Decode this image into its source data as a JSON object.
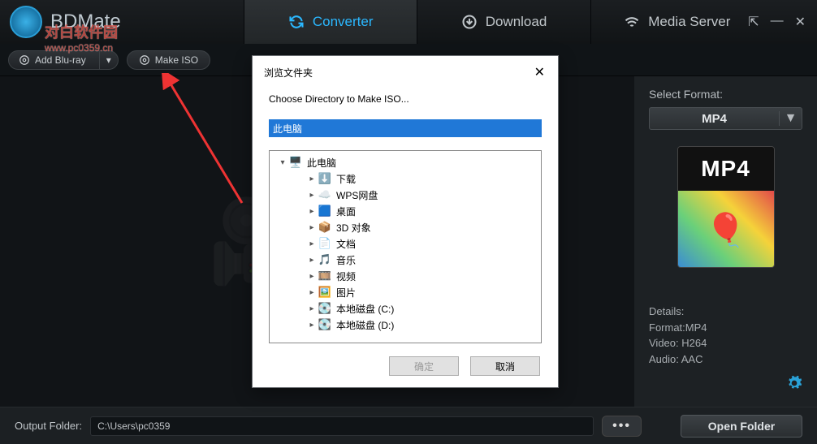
{
  "app": {
    "name": "BDMate"
  },
  "tabs": {
    "converter": "Converter",
    "download": "Download",
    "media_server": "Media Server"
  },
  "toolbar": {
    "add_bluray": "Add Blu-ray",
    "make_iso": "Make ISO"
  },
  "side": {
    "select_format": "Select Format:",
    "format": "MP4",
    "details_label": "Details:",
    "detail_format": "Format:MP4",
    "detail_video": "Video: H264",
    "detail_audio": "Audio: AAC"
  },
  "footer": {
    "label": "Output Folder:",
    "path": "C:\\Users\\pc0359",
    "open": "Open Folder"
  },
  "dialog": {
    "title": "浏览文件夹",
    "subtitle": "Choose Directory to Make ISO...",
    "selected": "此电脑",
    "ok": "确定",
    "cancel": "取消",
    "tree": [
      {
        "depth": 1,
        "toggle": "▾",
        "icon": "pc",
        "label": "此电脑"
      },
      {
        "depth": 2,
        "toggle": "▸",
        "icon": "dl",
        "label": "下载"
      },
      {
        "depth": 2,
        "toggle": "▸",
        "icon": "cloud",
        "label": "WPS网盘"
      },
      {
        "depth": 2,
        "toggle": "▸",
        "icon": "desk",
        "label": "桌面"
      },
      {
        "depth": 2,
        "toggle": "▸",
        "icon": "3d",
        "label": "3D 对象"
      },
      {
        "depth": 2,
        "toggle": "▸",
        "icon": "doc",
        "label": "文档"
      },
      {
        "depth": 2,
        "toggle": "▸",
        "icon": "music",
        "label": "音乐"
      },
      {
        "depth": 2,
        "toggle": "▸",
        "icon": "video",
        "label": "视频"
      },
      {
        "depth": 2,
        "toggle": "▸",
        "icon": "pic",
        "label": "图片"
      },
      {
        "depth": 2,
        "toggle": "▸",
        "icon": "drive",
        "label": "本地磁盘 (C:)"
      },
      {
        "depth": 2,
        "toggle": "▸",
        "icon": "drive",
        "label": "本地磁盘 (D:)"
      }
    ]
  },
  "watermark": {
    "line1": "对白软件园",
    "line2": "www.pc0359.cn"
  }
}
